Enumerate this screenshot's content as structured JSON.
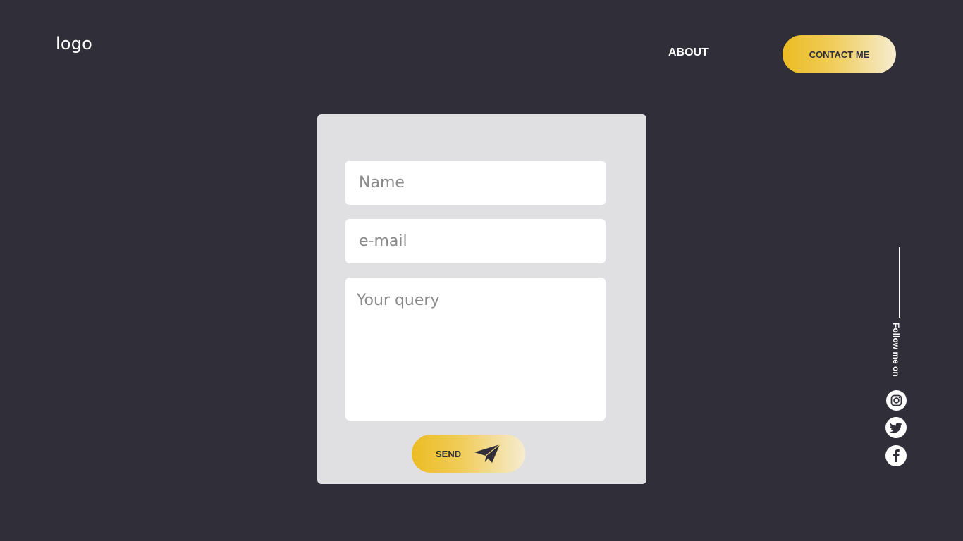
{
  "header": {
    "logo": "logo",
    "nav_about": "ABOUT",
    "contact_button": "CONTACT ME"
  },
  "form": {
    "name_placeholder": "Name",
    "email_placeholder": "e-mail",
    "query_placeholder": "Your query",
    "send_label": "SEND"
  },
  "social": {
    "follow_text": "Follow me on",
    "icons": [
      "instagram-icon",
      "twitter-icon",
      "facebook-icon"
    ]
  },
  "colors": {
    "background": "#2f2e39",
    "card": "#e0e0e2",
    "accent_start": "#ecbc23",
    "accent_end": "#f6ecd0"
  }
}
